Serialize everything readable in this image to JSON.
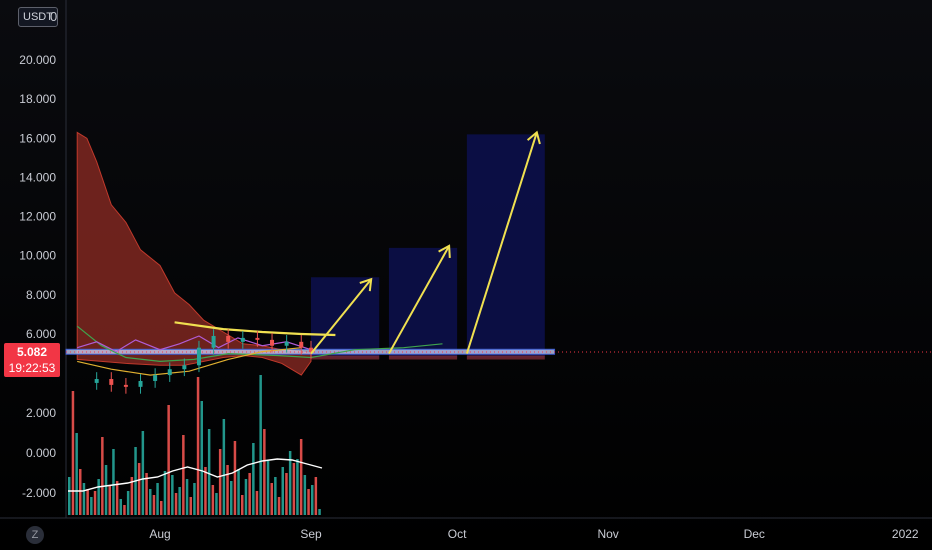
{
  "unit_label": "USDT",
  "unit_zero": "0",
  "price_tag": {
    "price": "5.082",
    "countdown": "19:22:53"
  },
  "timezone_button": "Z",
  "colors": {
    "background": "#000000",
    "cloud_red": "#8b2a22",
    "cloud_green": "#2e6b3a",
    "projection_box": "#0c0f4a",
    "arrow_yellow": "#f0e050",
    "bull_bar": "#26a69a",
    "bear_bar": "#ef5350",
    "price_line": "#f23645"
  },
  "chart_data": [
    {
      "type": "line",
      "title": "",
      "xlabel": "",
      "ylabel": "",
      "ylim": [
        2.4,
        21.2
      ],
      "y_ticks": [
        "20.000",
        "18.000",
        "16.000",
        "14.000",
        "12.000",
        "10.000",
        "8.000",
        "6.000"
      ],
      "x_ticks": [
        "Aug",
        "Sep",
        "Oct",
        "Nov",
        "Dec",
        "2022"
      ],
      "last_price": 5.082,
      "series": [
        {
          "kind": "cloud_upper",
          "x": [
            "2021-07-15",
            "2021-07-17",
            "2021-07-19",
            "2021-07-22",
            "2021-07-25",
            "2021-07-28",
            "2021-08-01",
            "2021-08-04",
            "2021-08-07",
            "2021-08-10",
            "2021-08-14",
            "2021-08-18",
            "2021-08-22",
            "2021-08-26",
            "2021-08-30",
            "2021-09-01"
          ],
          "values": [
            16.3,
            16.0,
            14.8,
            12.6,
            11.7,
            10.3,
            9.5,
            8.1,
            7.5,
            6.7,
            6.1,
            5.5,
            5.4,
            5.2,
            5.1,
            5.0
          ]
        },
        {
          "kind": "cloud_lower",
          "x": [
            "2021-07-15",
            "2021-07-20",
            "2021-07-25",
            "2021-08-01",
            "2021-08-06",
            "2021-08-10",
            "2021-08-14",
            "2021-08-18",
            "2021-08-22",
            "2021-08-26",
            "2021-08-30",
            "2021-09-01"
          ],
          "values": [
            4.7,
            4.6,
            4.5,
            4.4,
            4.4,
            4.6,
            4.8,
            4.9,
            4.8,
            4.5,
            3.9,
            4.6
          ]
        },
        {
          "kind": "resistance_curve",
          "x": [
            "2021-08-04",
            "2021-08-14",
            "2021-08-22",
            "2021-08-30",
            "2021-09-06"
          ],
          "values": [
            6.6,
            6.25,
            6.1,
            6.0,
            5.95
          ]
        },
        {
          "kind": "green_line",
          "x": [
            "2021-07-15",
            "2021-07-20",
            "2021-07-25",
            "2021-08-01",
            "2021-08-08",
            "2021-08-15",
            "2021-08-25",
            "2021-09-01",
            "2021-09-10",
            "2021-09-20",
            "2021-09-28"
          ],
          "values": [
            6.4,
            5.4,
            4.8,
            4.6,
            4.7,
            5.0,
            4.9,
            4.8,
            5.2,
            5.3,
            5.5
          ]
        },
        {
          "kind": "purple_line",
          "x": [
            "2021-07-15",
            "2021-07-19",
            "2021-07-23",
            "2021-07-27",
            "2021-08-01",
            "2021-08-05",
            "2021-08-09",
            "2021-08-13",
            "2021-08-17",
            "2021-08-22",
            "2021-08-27",
            "2021-09-01"
          ],
          "values": [
            5.3,
            5.6,
            5.1,
            5.7,
            5.2,
            5.5,
            5.9,
            5.3,
            5.8,
            5.4,
            5.6,
            5.2
          ]
        },
        {
          "kind": "orange_line",
          "x": [
            "2021-07-15",
            "2021-07-22",
            "2021-07-30",
            "2021-08-07",
            "2021-08-15",
            "2021-08-22",
            "2021-08-30"
          ],
          "values": [
            4.6,
            4.2,
            3.9,
            4.1,
            4.7,
            5.1,
            5.3
          ]
        },
        {
          "kind": "candles_close",
          "x": [
            "2021-07-19",
            "2021-07-22",
            "2021-07-25",
            "2021-07-28",
            "2021-07-31",
            "2021-08-03",
            "2021-08-06",
            "2021-08-09",
            "2021-08-12",
            "2021-08-15",
            "2021-08-18",
            "2021-08-21",
            "2021-08-24",
            "2021-08-27",
            "2021-08-30",
            "2021-09-01"
          ],
          "values": [
            3.7,
            3.4,
            3.3,
            3.6,
            3.9,
            4.2,
            4.4,
            5.3,
            5.9,
            5.6,
            5.8,
            5.7,
            5.4,
            5.6,
            5.3,
            5.08
          ]
        }
      ],
      "projections": [
        {
          "x_start": "2021-09-01",
          "x_end": "2021-09-15",
          "y_low": 4.8,
          "y_high": 8.9,
          "arrow_from": [
            5.0
          ],
          "arrow_to": [
            8.8
          ]
        },
        {
          "x_start": "2021-09-17",
          "x_end": "2021-10-01",
          "y_low": 4.8,
          "y_high": 10.4,
          "arrow_from": [
            5.0
          ],
          "arrow_to": [
            10.5
          ]
        },
        {
          "x_start": "2021-10-03",
          "x_end": "2021-10-19",
          "y_low": 4.8,
          "y_high": 16.2,
          "arrow_from": [
            5.0
          ],
          "arrow_to": [
            16.3
          ]
        }
      ]
    },
    {
      "type": "bar",
      "title": "",
      "ylim": [
        -3.1,
        4.0
      ],
      "y_ticks": [
        "2.000",
        "0.000",
        "-2.000"
      ],
      "values": [
        -1.2,
        3.1,
        1.0,
        -0.8,
        -1.5,
        -1.8,
        -2.2,
        -1.9,
        -1.3,
        0.8,
        -0.6,
        -1.6,
        0.2,
        -1.4,
        -2.3,
        -2.6,
        -1.9,
        -1.2,
        0.3,
        -0.5,
        1.1,
        -1.0,
        -1.8,
        -2.1,
        -1.5,
        -2.4,
        -0.9,
        2.4,
        -1.1,
        -2.0,
        -1.7,
        0.9,
        -1.3,
        -2.2,
        -1.5,
        3.8,
        2.6,
        -0.7,
        1.2,
        -1.6,
        -2.0,
        0.2,
        1.7,
        -0.6,
        -1.4,
        0.6,
        -0.8,
        -2.1,
        -1.3,
        -1.0,
        0.5,
        -1.9,
        3.9,
        1.2,
        -0.4,
        -1.5,
        -1.2,
        -2.2,
        -0.7,
        -1.0,
        0.1,
        -0.5,
        -0.3,
        0.7,
        -1.1,
        -1.8,
        -1.6,
        -1.2,
        -2.8
      ],
      "signal_line": [
        -1.9,
        -1.9,
        -1.7,
        -1.6,
        -1.5,
        -1.3,
        -1.2,
        -0.9,
        -0.7,
        -0.9,
        -1.2,
        -1.0,
        -0.6,
        -0.4,
        -0.3,
        -0.35,
        -0.55,
        -0.75
      ]
    }
  ]
}
